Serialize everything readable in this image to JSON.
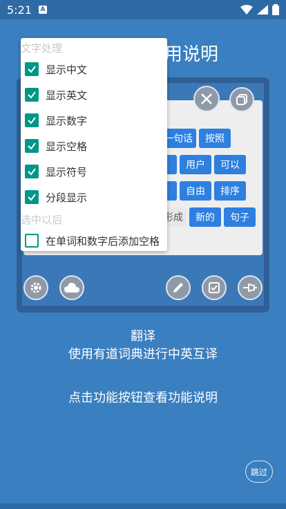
{
  "status": {
    "time": "5:21",
    "notif_icon_text": "A"
  },
  "title_partial": "用说明",
  "chips": [
    {
      "label": "一句话",
      "style": "blue"
    },
    {
      "label": "按照",
      "style": "blue"
    },
    {
      "label": "用户",
      "style": "blue"
    },
    {
      "label": "可以",
      "style": "blue"
    },
    {
      "label": "自由",
      "style": "blue"
    },
    {
      "label": "排序",
      "style": "blue"
    },
    {
      "label": "形成",
      "style": "light"
    },
    {
      "label": "新的",
      "style": "blue"
    },
    {
      "label": "句子",
      "style": "blue"
    }
  ],
  "popup": {
    "section1_title": "文字处理",
    "items": [
      {
        "label": "显示中文",
        "checked": true
      },
      {
        "label": "显示英文",
        "checked": true
      },
      {
        "label": "显示数字",
        "checked": true
      },
      {
        "label": "显示空格",
        "checked": true
      },
      {
        "label": "显示符号",
        "checked": true
      },
      {
        "label": "分段显示",
        "checked": true
      }
    ],
    "section2_title": "选中以后",
    "option_space": {
      "label": "在单词和数字后添加空格",
      "checked": false
    }
  },
  "feature": {
    "name": "翻译",
    "description": "使用有道词典进行中英互译",
    "hint": "点击功能按钮查看功能说明"
  },
  "skip_label": "跳过",
  "colors": {
    "background": "#3a7fc0",
    "chip": "#2e7fe0",
    "checkbox": "#009688"
  }
}
